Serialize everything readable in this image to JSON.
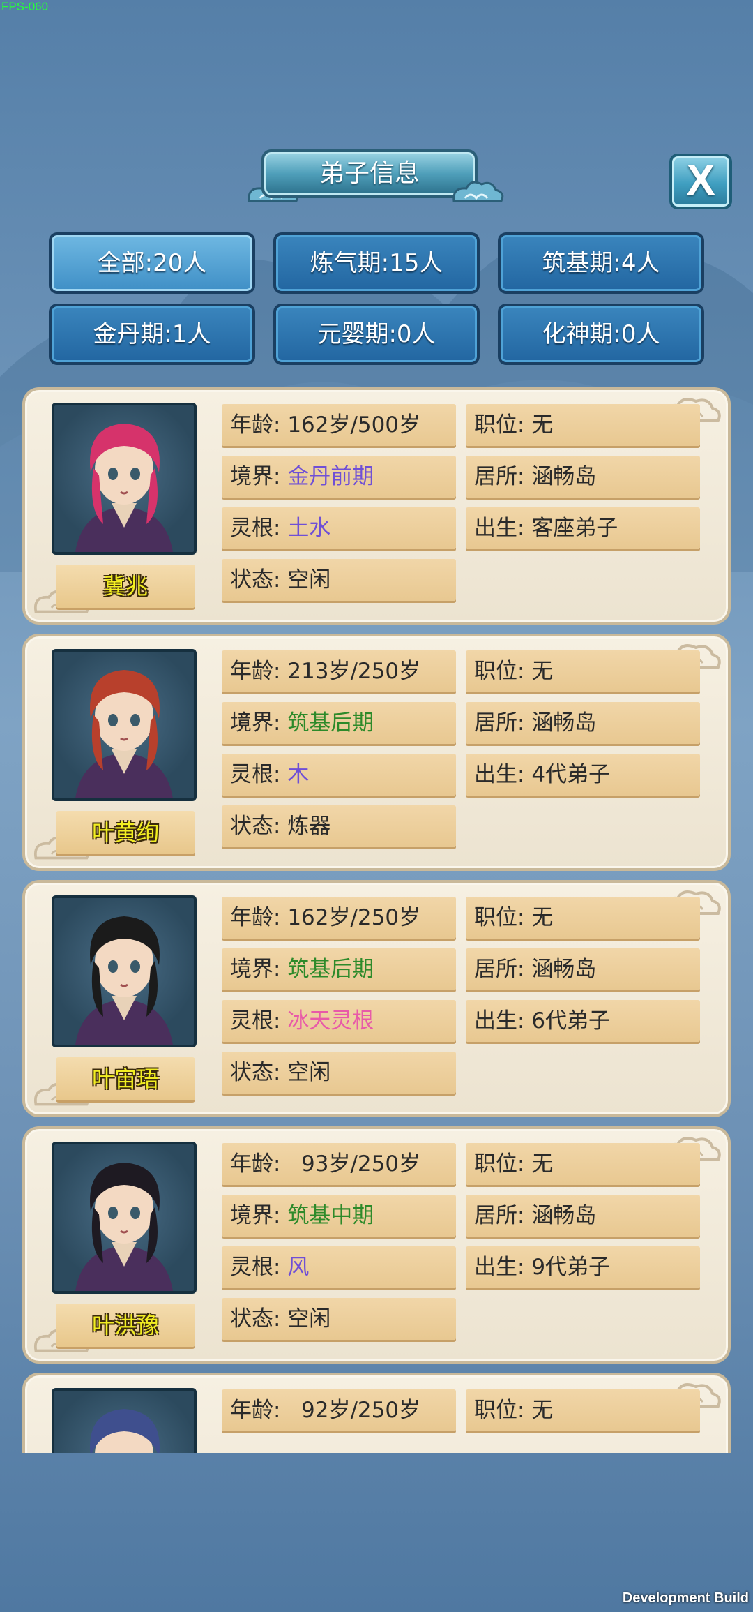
{
  "debug": {
    "fps": "FPS-060",
    "build": "Development Build"
  },
  "title": "弟子信息",
  "close_label": "X",
  "filters": [
    {
      "label": "全部:20人",
      "active": true
    },
    {
      "label": "炼气期:15人"
    },
    {
      "label": "筑基期:4人"
    },
    {
      "label": "金丹期:1人"
    },
    {
      "label": "元婴期:0人"
    },
    {
      "label": "化神期:0人"
    }
  ],
  "labels": {
    "age": "年龄:",
    "position": "职位:",
    "realm": "境界:",
    "residence": "居所:",
    "root": "灵根:",
    "birth": "出生:",
    "status": "状态:"
  },
  "disciples": [
    {
      "name": "冀兆",
      "age": "162岁/500岁",
      "position": "无",
      "realm": "金丹前期",
      "residence": "涵畅岛",
      "root": "土水",
      "birth": "客座弟子",
      "status": "空闲",
      "realm_color": "#6f4fd6",
      "root_color": "#6f4fd6",
      "hair": "#d6336b"
    },
    {
      "name": "叶黄绚",
      "age": "213岁/250岁",
      "position": "无",
      "realm": "筑基后期",
      "residence": "涵畅岛",
      "root": "木",
      "birth": "4代弟子",
      "status": "炼器",
      "realm_color": "#2d8a2a",
      "root_color": "#6f4fd6",
      "hair": "#b8402c"
    },
    {
      "name": "叶宙珸",
      "age": "162岁/250岁",
      "position": "无",
      "realm": "筑基后期",
      "residence": "涵畅岛",
      "root": "冰天灵根",
      "birth": "6代弟子",
      "status": "空闲",
      "realm_color": "#2d8a2a",
      "root_color": "#e85aa8",
      "hair": "#1b1b1b"
    },
    {
      "name": "叶洪豫",
      "age": "  93岁/250岁",
      "position": "无",
      "realm": "筑基中期",
      "residence": "涵畅岛",
      "root": "风",
      "birth": "9代弟子",
      "status": "空闲",
      "realm_color": "#2d8a2a",
      "root_color": "#6f4fd6",
      "hair": "#1e1a22"
    },
    {
      "age": "  92岁/250岁",
      "position": "无",
      "hair": "#3f4f8e"
    }
  ]
}
